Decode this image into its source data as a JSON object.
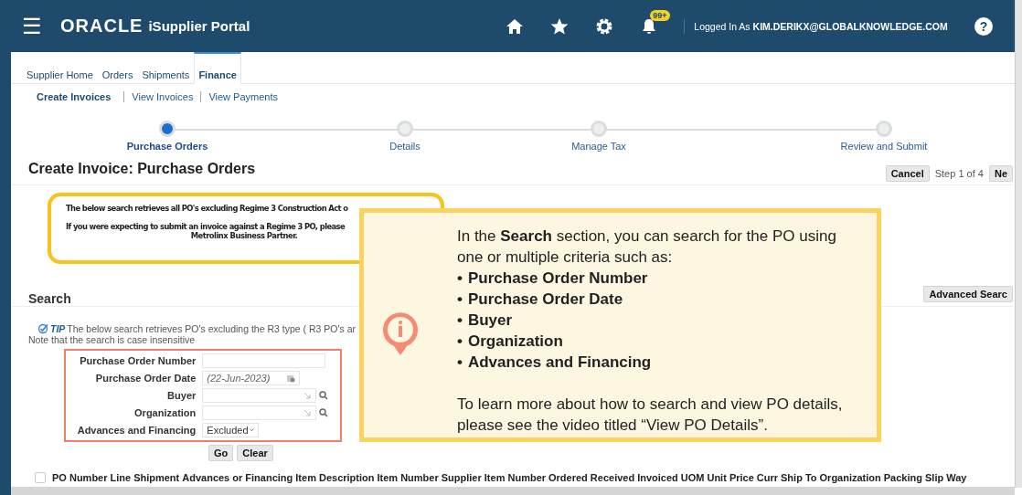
{
  "header": {
    "menu_glyph": "☰",
    "logo": "ORACLE",
    "product": "iSupplier Portal",
    "notification_badge": "99+",
    "user_text": "Logged In As **KIM.DERIKX@GLOBALKNOWLEDGE.COM**",
    "help_glyph": "?"
  },
  "tabs": [
    {
      "label": "Supplier Home",
      "selected": false
    },
    {
      "label": "Orders",
      "selected": false
    },
    {
      "label": "Shipments",
      "selected": false
    },
    {
      "label": "Finance",
      "selected": true
    }
  ],
  "subtabs": [
    {
      "label": "Create Invoices",
      "selected": true
    },
    {
      "label": "View Invoices",
      "selected": false
    },
    {
      "label": "View Payments",
      "selected": false
    }
  ],
  "steps": [
    {
      "label": "Purchase Orders",
      "selected": true
    },
    {
      "label": "Details",
      "selected": false
    },
    {
      "label": "Manage Tax",
      "selected": false
    },
    {
      "label": "Review and Submit",
      "selected": false
    }
  ],
  "page_title": "Create Invoice: Purchase Orders",
  "actions": {
    "cancel": "Cancel",
    "step_text": "Step 1 of 4",
    "next": "Ne"
  },
  "notice": {
    "line_1": "The below search retrieves all PO's excluding Regime 3 Construction Act o",
    "line_2": "If you were expecting to submit an invoice against a Regime 3 PO, please",
    "line_3": "Metrolinx Business Partner."
  },
  "search": {
    "title": "Search",
    "advanced_button": "Advanced Searc",
    "tip_label": "TIP",
    "tip_text": "The below search retrieves PO's excluding the R3 type ( R3 PO's ar",
    "note": "Note that the search is case insensitive",
    "fields": [
      {
        "kind": "text",
        "label": "Purchase Order Number"
      },
      {
        "kind": "date",
        "label": "Purchase Order Date",
        "placeholder": "(22-Jun-2023)"
      },
      {
        "kind": "lookup",
        "label": "Buyer"
      },
      {
        "kind": "lookup",
        "label": "Organization"
      },
      {
        "kind": "select",
        "label": "Advances and Financing",
        "value": "Excluded"
      }
    ],
    "buttons": [
      "Go",
      "Clear"
    ]
  },
  "table": {
    "checked": false,
    "columns": [
      "PO Number",
      "Line",
      "Shipment",
      "Advances or Financing",
      "Item Description",
      "Item Number",
      "Supplier Item Number",
      "Ordered",
      "Received",
      "Invoiced",
      "UOM",
      "Unit Price",
      "Curr",
      "Ship To",
      "Organization",
      "Packing Slip",
      "Way"
    ]
  },
  "callout": {
    "intro": "In the **Search** section, you can search for the PO using one or multiple criteria such as:",
    "bullet_glyph": "•",
    "items": [
      "Purchase Order Number",
      "Purchase Order Date",
      "Buyer",
      "Organization",
      "Advances and Financing"
    ],
    "outro": "To learn more about how to search and view PO details, please see the video titled “View PO Details”."
  }
}
